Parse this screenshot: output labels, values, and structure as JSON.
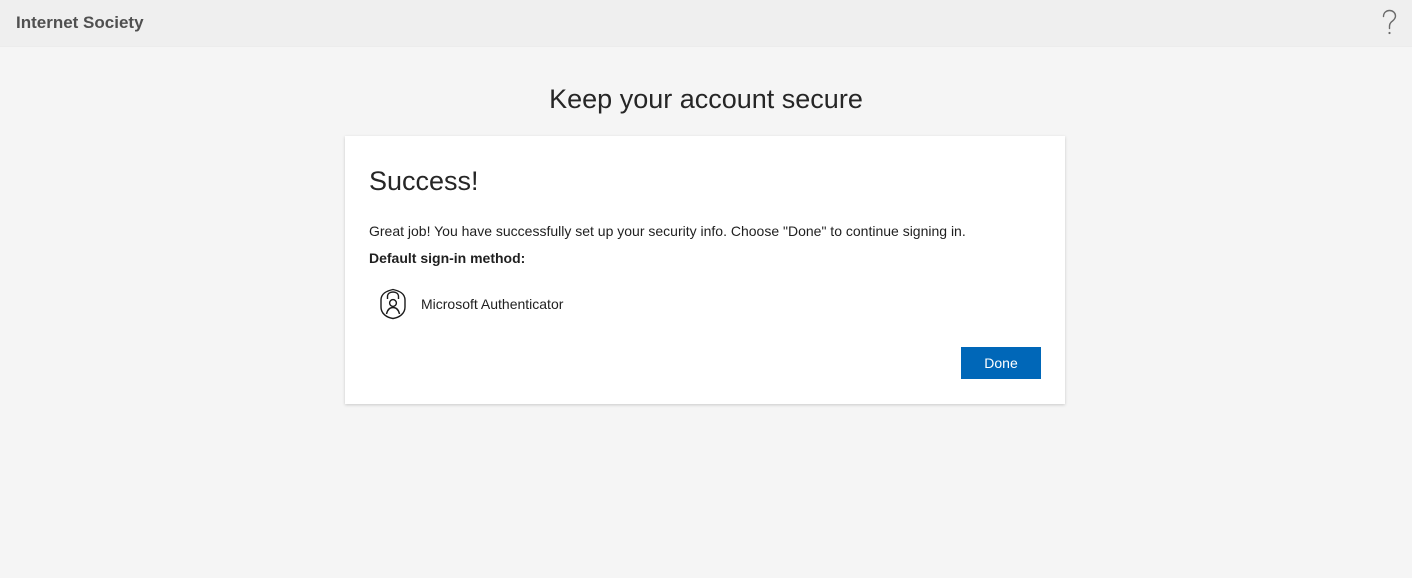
{
  "header": {
    "org_name": "Internet Society",
    "help_icon": "question-mark-icon"
  },
  "page": {
    "heading": "Keep your account secure"
  },
  "card": {
    "title": "Success!",
    "message": "Great job! You have successfully set up your security info. Choose \"Done\" to continue signing in.",
    "method_label": "Default sign-in method:",
    "method": {
      "icon": "authenticator-lock-icon",
      "name": "Microsoft Authenticator"
    },
    "done_label": "Done"
  },
  "colors": {
    "primary_button": "#0067b8",
    "page_background": "#f5f5f5",
    "header_background": "#efefef"
  }
}
